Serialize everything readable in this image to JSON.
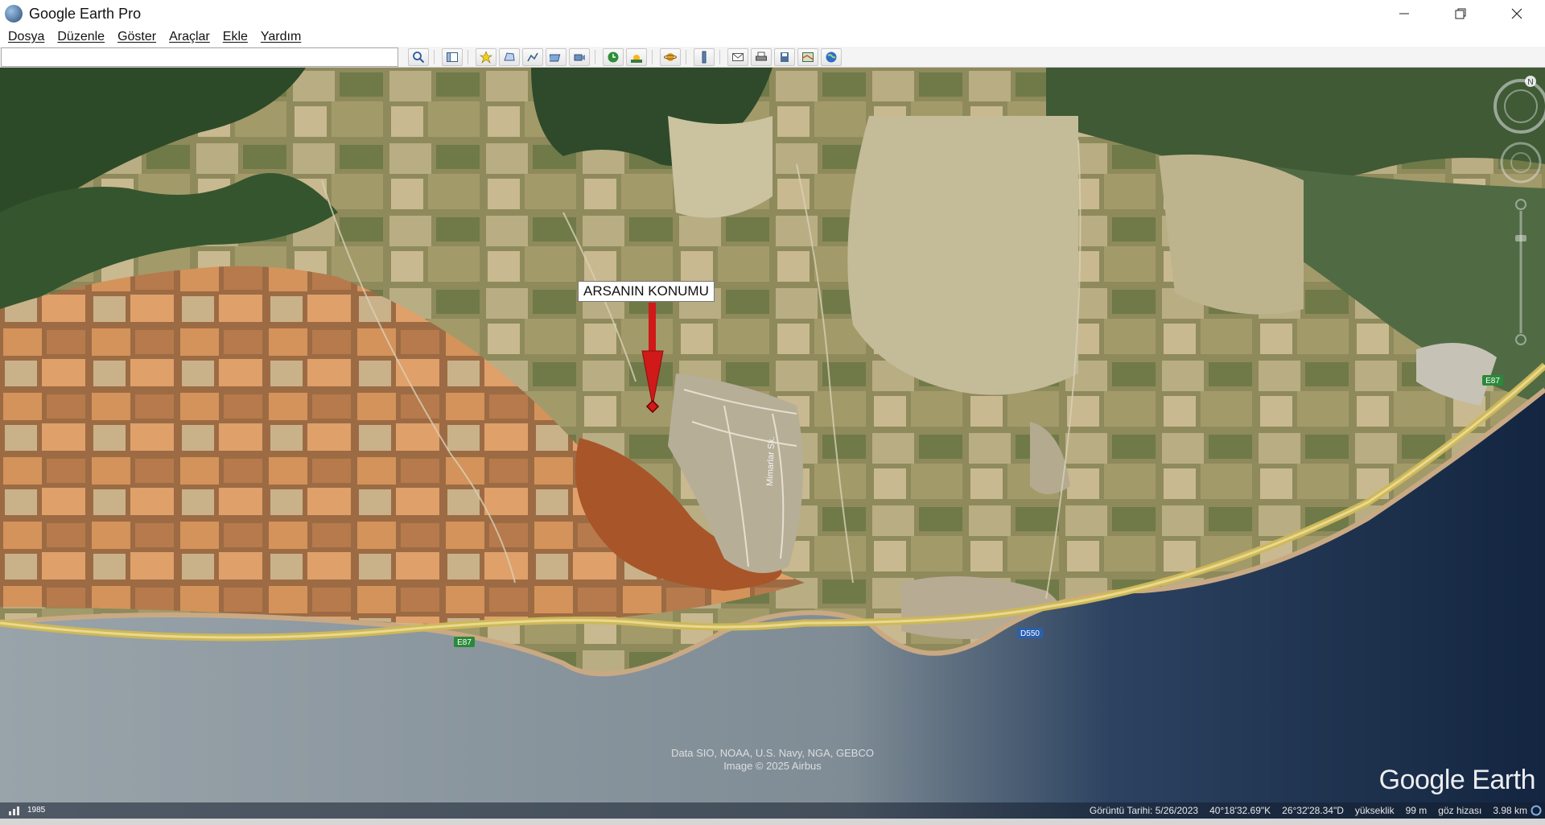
{
  "window": {
    "title": "Google Earth Pro",
    "controls": [
      "minimize-icon",
      "restore-icon",
      "close-icon"
    ]
  },
  "menu": {
    "items": [
      "Dosya",
      "Düzenle",
      "Göster",
      "Araçlar",
      "Ekle",
      "Yardım"
    ]
  },
  "toolbar": {
    "search_value": "",
    "icons": [
      "search-icon",
      "sidebar-toggle-icon",
      "placemark-icon",
      "polygon-icon",
      "path-icon",
      "image-overlay-icon",
      "record-tour-icon",
      "historical-imagery-icon",
      "sunlight-icon",
      "planets-icon",
      "ruler-icon",
      "email-icon",
      "print-icon",
      "save-image-icon",
      "view-in-maps-icon",
      "earth-icon"
    ]
  },
  "map": {
    "placemark_label": "ARSANIN KONUMU",
    "road_labels": {
      "e87_left": "E87",
      "d550": "D550",
      "e87_right": "E87",
      "street": "Mimarlar Sk."
    },
    "attribution_line1": "Data SIO, NOAA, U.S. Navy, NGA, GEBCO",
    "attribution_line2": "Image © 2025 Airbus",
    "logo": "Google Earth"
  },
  "status": {
    "year": "1985",
    "imagery_date": "Görüntü Tarihi: 5/26/2023",
    "latitude": "40°18'32.69\"K",
    "longitude": "26°32'28.34\"D",
    "elevation_label": "yükseklik",
    "elevation_value": "99 m",
    "eye_alt_label": "göz hizası",
    "eye_alt_value": "3.98 km"
  },
  "colors": {
    "sea_light": "#8e9aa3",
    "sea_dark": "#1b2d4a",
    "highway": "#d8c46a",
    "marker": "#d01919"
  }
}
